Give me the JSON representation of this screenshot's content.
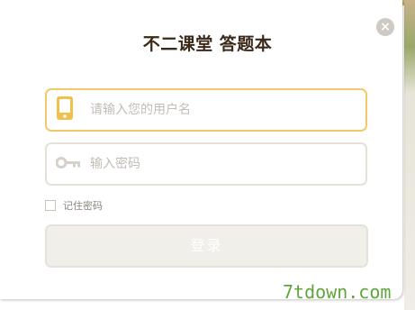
{
  "dialog": {
    "title": "不二课堂 答题本",
    "close_label": "×"
  },
  "login_form": {
    "username_placeholder": "请输入您的用户名",
    "username_value": "",
    "password_placeholder": "输入密码",
    "password_value": "",
    "remember_label": "记住密码",
    "remember_checked": false,
    "login_label": "登录"
  },
  "icons": {
    "username": "phone-icon",
    "password": "key-icon",
    "close": "close-icon"
  },
  "colors": {
    "title_text": "#3b2a1a",
    "active_field_border": "#f2c86a",
    "icon_yellow": "#f0c04a",
    "icon_grey": "#d6d1c8",
    "button_bg": "#f1efea",
    "watermark": "#5fa63a"
  },
  "watermark": {
    "text": "7tdown.com"
  }
}
